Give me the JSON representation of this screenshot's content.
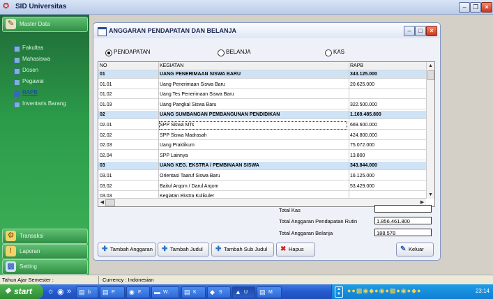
{
  "window": {
    "title": "SID Universitas"
  },
  "sidebar": {
    "master_label": "Master Data",
    "items": [
      {
        "label": "Fakultas"
      },
      {
        "label": "Mahasiswa"
      },
      {
        "label": "Dosen"
      },
      {
        "label": "Pegawai"
      },
      {
        "label": "RAPB"
      },
      {
        "label": "Inventaris Barang"
      }
    ],
    "bottom": [
      {
        "label": "Transaksi"
      },
      {
        "label": "Laporan"
      },
      {
        "label": "Setting"
      }
    ]
  },
  "dialog": {
    "title": "ANGGARAN PENDAPATAN DAN BELANJA",
    "radios": [
      {
        "label": "PENDAPATAN",
        "checked": true
      },
      {
        "label": "BELANJA",
        "checked": false
      },
      {
        "label": "KAS",
        "checked": false
      }
    ],
    "table": {
      "headers": [
        "NO",
        "KEGIATAN",
        "RAPB"
      ],
      "rows": [
        {
          "no": "01",
          "kegiatan": "UANG PENERIMAAN SISWA BARU",
          "rapb": "343.125.000",
          "group": true
        },
        {
          "no": "01.01",
          "kegiatan": "Uang Penerimaan Siswa Baru",
          "rapb": "20.625.000",
          "group": false
        },
        {
          "no": "01.02",
          "kegiatan": "Uang Tes Penerimaan Siswa Baru",
          "rapb": "",
          "group": false
        },
        {
          "no": "01.03",
          "kegiatan": "Uang Pangkal Siswa Baru",
          "rapb": "322.500.000",
          "group": false
        },
        {
          "no": "02",
          "kegiatan": "UANG SUMBANGAN PEMBANGUNAN PENDIDIKAN",
          "rapb": "1.169.485.800",
          "group": true
        },
        {
          "no": "02.01",
          "kegiatan": "SPP Siswa MTs",
          "rapb": "669.600.000",
          "group": false
        },
        {
          "no": "02.02",
          "kegiatan": "SPP Siswa Madrasah",
          "rapb": "424.800.000",
          "group": false
        },
        {
          "no": "02.03",
          "kegiatan": "Uang Praktikum",
          "rapb": "75.072.000",
          "group": false
        },
        {
          "no": "02.04",
          "kegiatan": "SPP Lainnya",
          "rapb": "13.800",
          "group": false
        },
        {
          "no": "03",
          "kegiatan": "UANG KEG. EKSTRA / PEMBINAAN SISWA",
          "rapb": "343.844.000",
          "group": true
        },
        {
          "no": "03.01",
          "kegiatan": "Orientasi Taaruf Siswa Baru",
          "rapb": "16.125.000",
          "group": false
        },
        {
          "no": "03.02",
          "kegiatan": "Baitul Arqom / Darul Arqom",
          "rapb": "53.429.000",
          "group": false
        },
        {
          "no": "03.03",
          "kegiatan": "Kegiatan Ekstra Kulikuler",
          "rapb": "",
          "group": false
        }
      ]
    },
    "totals": {
      "kas_label": "Total Kas",
      "kas_value": "",
      "pendapatan_label": "Total Anggaran Pendapatan Rutin",
      "pendapatan_value": "1.856.461.800",
      "belanja_label": "Total Anggaran Belanja",
      "belanja_value": "188.578"
    },
    "buttons": {
      "tambah_anggaran": "Tambah Anggaran",
      "tambah_judul": "Tambah Judul",
      "tambah_sub_judul": "Tambah Sub Judul",
      "hapus": "Hapus",
      "keluar": "Keluar"
    }
  },
  "statusbar": {
    "tahun": "Tahun Ajar Semester :",
    "currency": "Currency : Indonesian"
  },
  "taskbar": {
    "start": "start",
    "tasks": [
      {
        "label": "b."
      },
      {
        "label": "P."
      },
      {
        "label": "F."
      },
      {
        "label": "W."
      },
      {
        "label": "K"
      },
      {
        "label": "S"
      },
      {
        "label": "U"
      },
      {
        "label": "M"
      }
    ],
    "clock": "23:14"
  },
  "colors": {
    "sidebar": "#2b9b49",
    "group_row": "#cfe3f7",
    "titlebar": "#b9cbe8",
    "taskbar": "#245ad0"
  }
}
